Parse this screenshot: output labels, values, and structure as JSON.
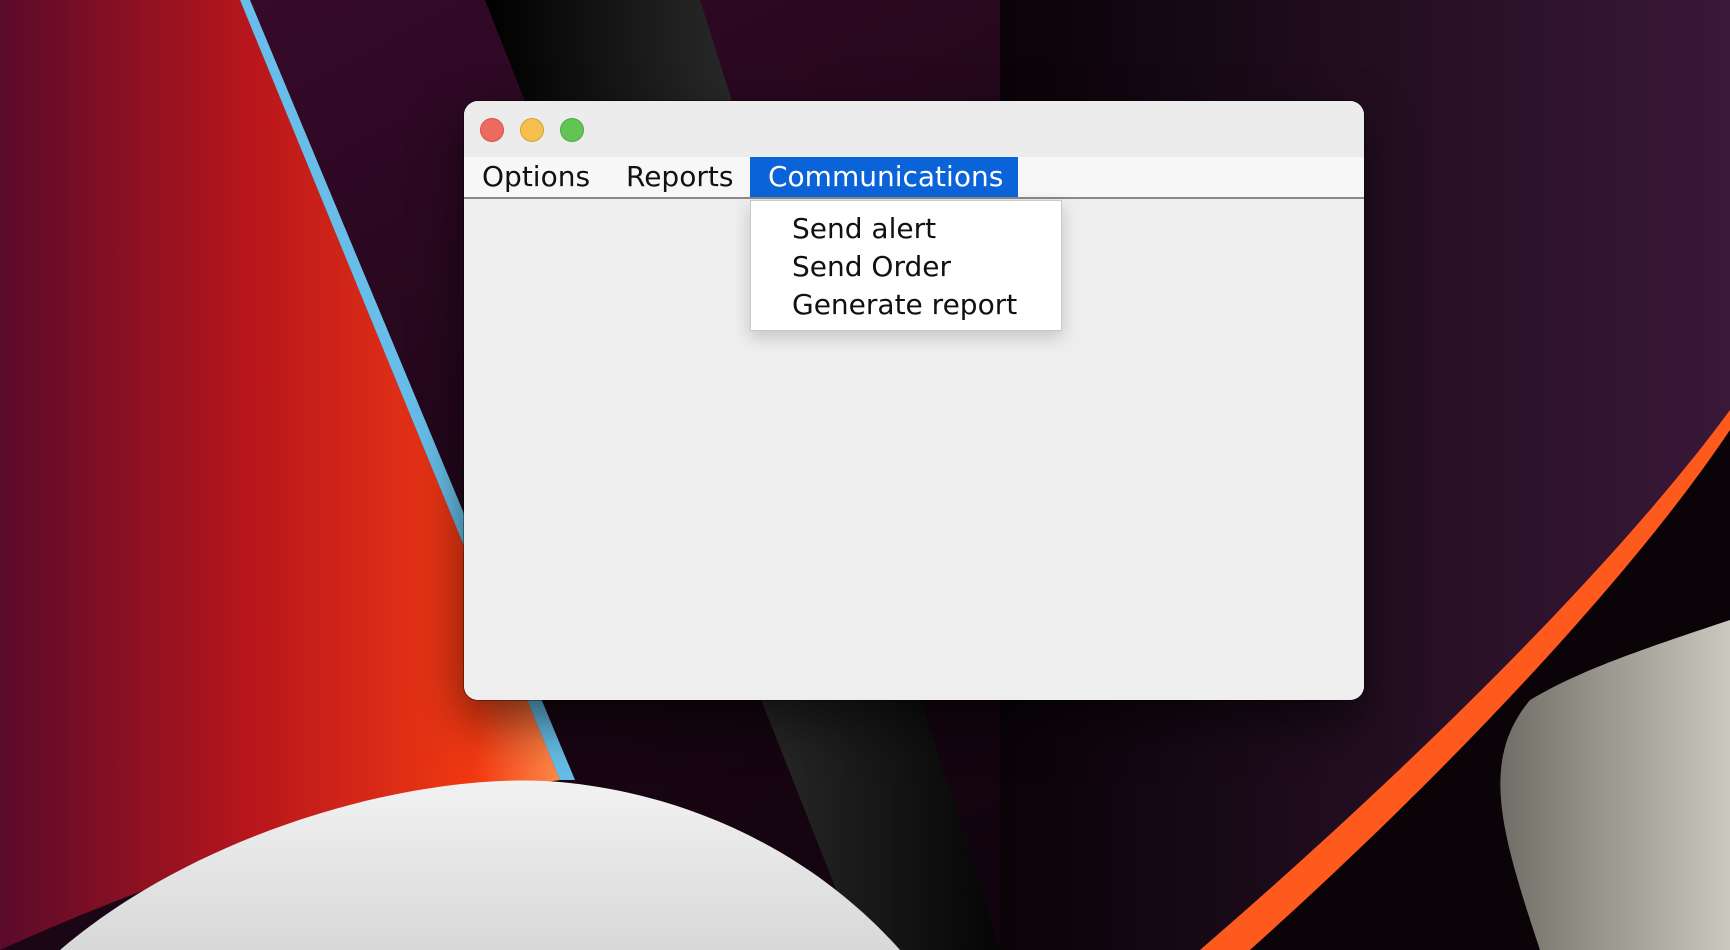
{
  "window": {
    "controls": [
      {
        "name": "close",
        "color": "#ed6a5e"
      },
      {
        "name": "minimize",
        "color": "#f5bf4f"
      },
      {
        "name": "zoom",
        "color": "#61c554"
      }
    ]
  },
  "menubar": {
    "items": [
      {
        "label": "Options"
      },
      {
        "label": "Reports"
      },
      {
        "label": "Communications",
        "active": true
      }
    ]
  },
  "dropdown": {
    "items": [
      {
        "label": "Send alert"
      },
      {
        "label": "Send Order"
      },
      {
        "label": "Generate report"
      }
    ]
  },
  "colors": {
    "menu_highlight": "#0a63d8",
    "window_background": "#eeeeee"
  }
}
